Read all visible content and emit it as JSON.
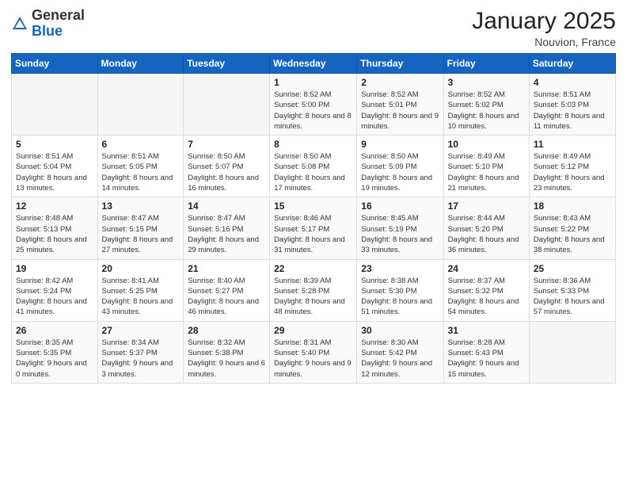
{
  "header": {
    "logo_general": "General",
    "logo_blue": "Blue",
    "month_title": "January 2025",
    "location": "Nouvion, France"
  },
  "weekdays": [
    "Sunday",
    "Monday",
    "Tuesday",
    "Wednesday",
    "Thursday",
    "Friday",
    "Saturday"
  ],
  "weeks": [
    [
      {
        "day": "",
        "info": ""
      },
      {
        "day": "",
        "info": ""
      },
      {
        "day": "",
        "info": ""
      },
      {
        "day": "1",
        "info": "Sunrise: 8:52 AM\nSunset: 5:00 PM\nDaylight: 8 hours\nand 8 minutes."
      },
      {
        "day": "2",
        "info": "Sunrise: 8:52 AM\nSunset: 5:01 PM\nDaylight: 8 hours\nand 9 minutes."
      },
      {
        "day": "3",
        "info": "Sunrise: 8:52 AM\nSunset: 5:02 PM\nDaylight: 8 hours\nand 10 minutes."
      },
      {
        "day": "4",
        "info": "Sunrise: 8:51 AM\nSunset: 5:03 PM\nDaylight: 8 hours\nand 11 minutes."
      }
    ],
    [
      {
        "day": "5",
        "info": "Sunrise: 8:51 AM\nSunset: 5:04 PM\nDaylight: 8 hours\nand 13 minutes."
      },
      {
        "day": "6",
        "info": "Sunrise: 8:51 AM\nSunset: 5:05 PM\nDaylight: 8 hours\nand 14 minutes."
      },
      {
        "day": "7",
        "info": "Sunrise: 8:50 AM\nSunset: 5:07 PM\nDaylight: 8 hours\nand 16 minutes."
      },
      {
        "day": "8",
        "info": "Sunrise: 8:50 AM\nSunset: 5:08 PM\nDaylight: 8 hours\nand 17 minutes."
      },
      {
        "day": "9",
        "info": "Sunrise: 8:50 AM\nSunset: 5:09 PM\nDaylight: 8 hours\nand 19 minutes."
      },
      {
        "day": "10",
        "info": "Sunrise: 8:49 AM\nSunset: 5:10 PM\nDaylight: 8 hours\nand 21 minutes."
      },
      {
        "day": "11",
        "info": "Sunrise: 8:49 AM\nSunset: 5:12 PM\nDaylight: 8 hours\nand 23 minutes."
      }
    ],
    [
      {
        "day": "12",
        "info": "Sunrise: 8:48 AM\nSunset: 5:13 PM\nDaylight: 8 hours\nand 25 minutes."
      },
      {
        "day": "13",
        "info": "Sunrise: 8:47 AM\nSunset: 5:15 PM\nDaylight: 8 hours\nand 27 minutes."
      },
      {
        "day": "14",
        "info": "Sunrise: 8:47 AM\nSunset: 5:16 PM\nDaylight: 8 hours\nand 29 minutes."
      },
      {
        "day": "15",
        "info": "Sunrise: 8:46 AM\nSunset: 5:17 PM\nDaylight: 8 hours\nand 31 minutes."
      },
      {
        "day": "16",
        "info": "Sunrise: 8:45 AM\nSunset: 5:19 PM\nDaylight: 8 hours\nand 33 minutes."
      },
      {
        "day": "17",
        "info": "Sunrise: 8:44 AM\nSunset: 5:20 PM\nDaylight: 8 hours\nand 36 minutes."
      },
      {
        "day": "18",
        "info": "Sunrise: 8:43 AM\nSunset: 5:22 PM\nDaylight: 8 hours\nand 38 minutes."
      }
    ],
    [
      {
        "day": "19",
        "info": "Sunrise: 8:42 AM\nSunset: 5:24 PM\nDaylight: 8 hours\nand 41 minutes."
      },
      {
        "day": "20",
        "info": "Sunrise: 8:41 AM\nSunset: 5:25 PM\nDaylight: 8 hours\nand 43 minutes."
      },
      {
        "day": "21",
        "info": "Sunrise: 8:40 AM\nSunset: 5:27 PM\nDaylight: 8 hours\nand 46 minutes."
      },
      {
        "day": "22",
        "info": "Sunrise: 8:39 AM\nSunset: 5:28 PM\nDaylight: 8 hours\nand 48 minutes."
      },
      {
        "day": "23",
        "info": "Sunrise: 8:38 AM\nSunset: 5:30 PM\nDaylight: 8 hours\nand 51 minutes."
      },
      {
        "day": "24",
        "info": "Sunrise: 8:37 AM\nSunset: 5:32 PM\nDaylight: 8 hours\nand 54 minutes."
      },
      {
        "day": "25",
        "info": "Sunrise: 8:36 AM\nSunset: 5:33 PM\nDaylight: 8 hours\nand 57 minutes."
      }
    ],
    [
      {
        "day": "26",
        "info": "Sunrise: 8:35 AM\nSunset: 5:35 PM\nDaylight: 9 hours\nand 0 minutes."
      },
      {
        "day": "27",
        "info": "Sunrise: 8:34 AM\nSunset: 5:37 PM\nDaylight: 9 hours\nand 3 minutes."
      },
      {
        "day": "28",
        "info": "Sunrise: 8:32 AM\nSunset: 5:38 PM\nDaylight: 9 hours\nand 6 minutes."
      },
      {
        "day": "29",
        "info": "Sunrise: 8:31 AM\nSunset: 5:40 PM\nDaylight: 9 hours\nand 9 minutes."
      },
      {
        "day": "30",
        "info": "Sunrise: 8:30 AM\nSunset: 5:42 PM\nDaylight: 9 hours\nand 12 minutes."
      },
      {
        "day": "31",
        "info": "Sunrise: 8:28 AM\nSunset: 5:43 PM\nDaylight: 9 hours\nand 15 minutes."
      },
      {
        "day": "",
        "info": ""
      }
    ]
  ]
}
